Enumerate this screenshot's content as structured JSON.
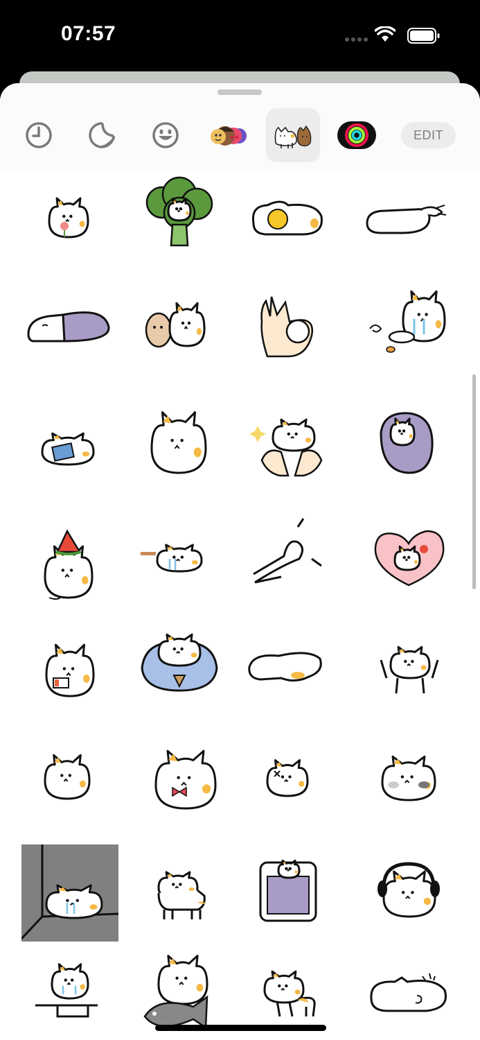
{
  "status_bar": {
    "time": "07:57"
  },
  "tabs": [
    {
      "name": "recents-tab",
      "icon": "clock-icon"
    },
    {
      "name": "stickers-tab",
      "icon": "sticker-peel-icon"
    },
    {
      "name": "emoji-tab",
      "icon": "smiley-icon"
    },
    {
      "name": "memoji-tab",
      "icon": "memoji-faces-icon"
    },
    {
      "name": "cat-sticker-pack-tab",
      "icon": "cat-sticker-icon",
      "selected": true
    },
    {
      "name": "activity-tab",
      "icon": "activity-rings-icon"
    }
  ],
  "edit_label": "EDIT",
  "stickers": [
    "cat-holding-flower",
    "cat-broccoli",
    "cat-fried-egg",
    "cat-lying-pet",
    "cat-sleeping-blanket",
    "cat-with-potato",
    "ok-hand-cat",
    "cat-crying-bowl",
    "cat-reading-book",
    "round-cat",
    "cat-in-hands",
    "cat-wrapped-blanket",
    "cat-watermelon-hat",
    "cat-crying-long",
    "arm-stretch",
    "cat-heart-flower",
    "cat-low-battery",
    "cat-shirt-collar",
    "cat-melted",
    "cat-arms-up",
    "cat-blob-plain",
    "cat-bowtie",
    "cat-dizzy",
    "cat-blush",
    "cat-crying-corner",
    "cat-walking-sad",
    "cat-tv-frame",
    "cat-headphones",
    "cat-desk-crying",
    "cat-fish",
    "cat-walking",
    "cat-lying-sigh"
  ],
  "colors": {
    "accent_orange": "#f5b944",
    "blanket_purple": "#a89cc6",
    "broccoli_green": "#5a9a3c",
    "corner_gray": "#808080"
  }
}
